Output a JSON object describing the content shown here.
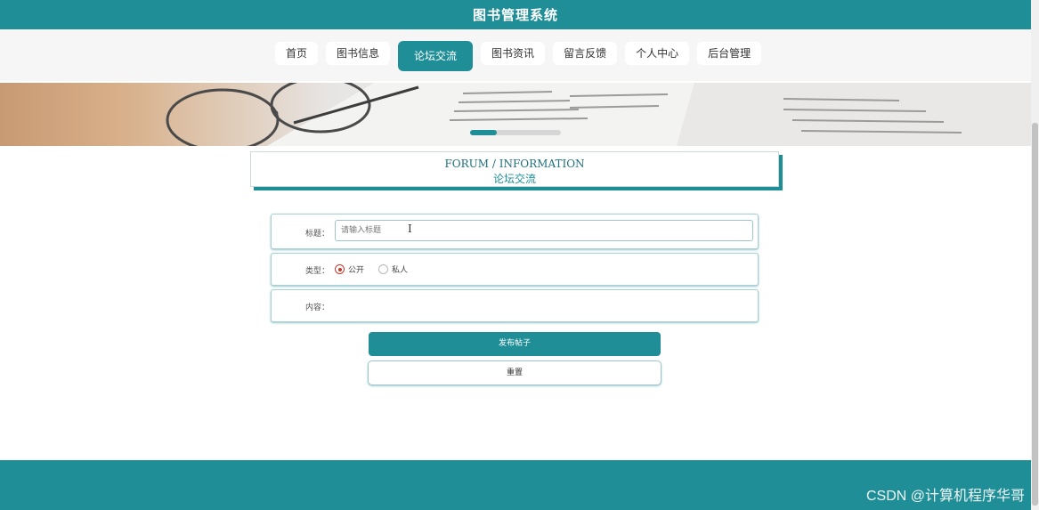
{
  "app": {
    "title": "图书管理系统"
  },
  "nav": {
    "items": [
      {
        "label": "首页",
        "active": false
      },
      {
        "label": "图书信息",
        "active": false
      },
      {
        "label": "论坛交流",
        "active": true
      },
      {
        "label": "图书资讯",
        "active": false
      },
      {
        "label": "留言反馈",
        "active": false
      },
      {
        "label": "个人中心",
        "active": false
      },
      {
        "label": "后台管理",
        "active": false
      }
    ]
  },
  "section": {
    "title_en": "FORUM / INFORMATION",
    "title_cn": "论坛交流"
  },
  "form": {
    "title_label": "标题：",
    "title_placeholder": "请输入标题",
    "type_label": "类型：",
    "type_options": [
      {
        "label": "公开",
        "checked": true
      },
      {
        "label": "私人",
        "checked": false
      }
    ],
    "content_label": "内容："
  },
  "buttons": {
    "submit_label": "发布帖子",
    "reset_label": "重置"
  },
  "watermark": "CSDN @计算机程序华哥",
  "colors": {
    "primary": "#1f8e97",
    "radio_checked": "#c0392b"
  }
}
